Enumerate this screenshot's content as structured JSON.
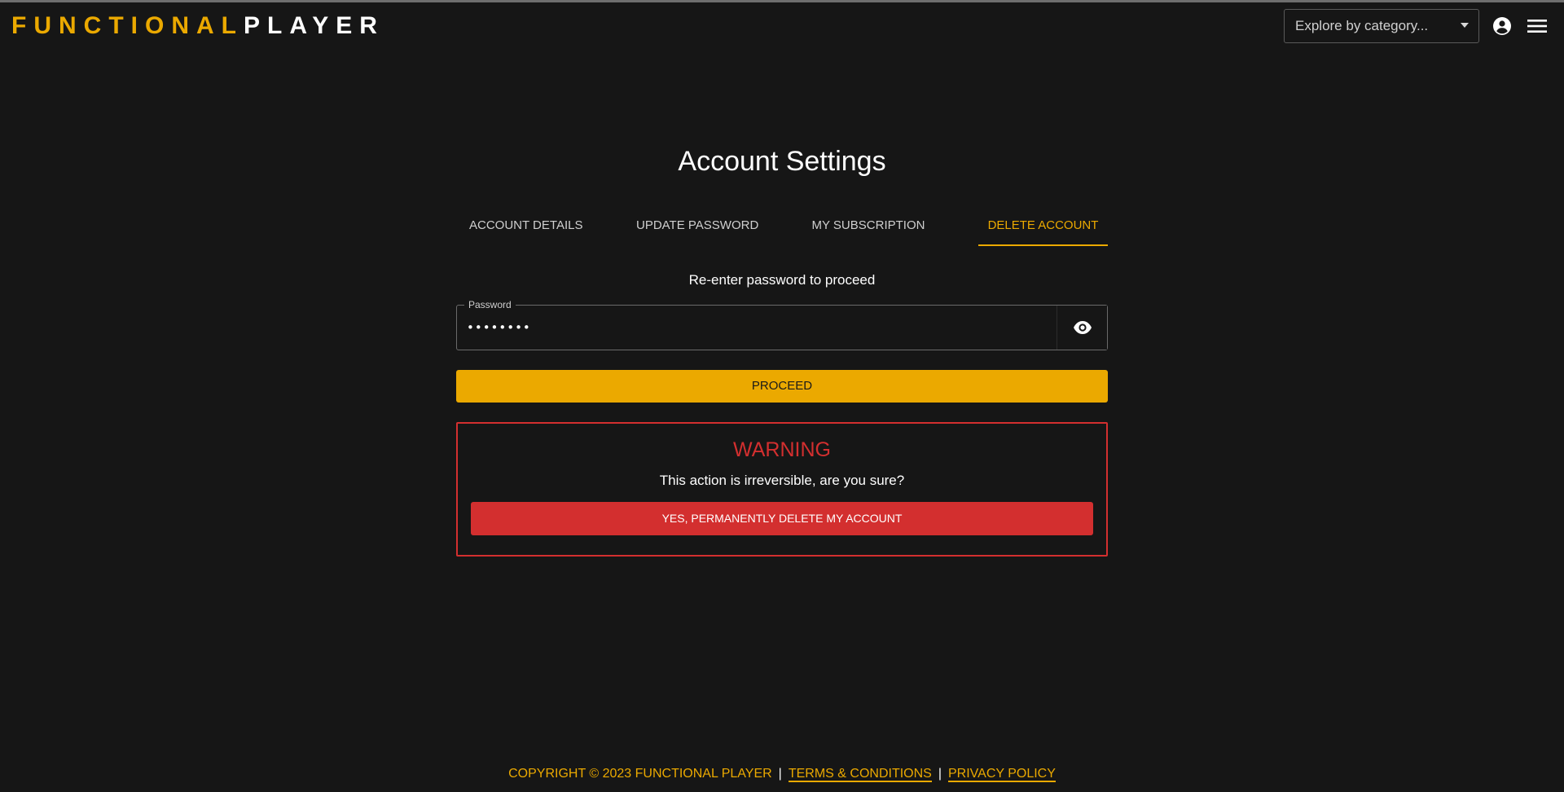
{
  "header": {
    "logo_part1": "FUNCTIONAL",
    "logo_part2": "PLAYER",
    "category_placeholder": "Explore by category...",
    "account_icon": "account-circle-icon",
    "menu_icon": "hamburger-menu-icon"
  },
  "page": {
    "title": "Account Settings",
    "tabs": [
      {
        "label": "ACCOUNT DETAILS",
        "active": false
      },
      {
        "label": "UPDATE PASSWORD",
        "active": false
      },
      {
        "label": "MY SUBSCRIPTION",
        "active": false
      },
      {
        "label": "DELETE ACCOUNT",
        "active": true
      }
    ]
  },
  "delete_section": {
    "prompt": "Re-enter password to proceed",
    "password_label": "Password",
    "password_value": "••••••••",
    "visibility_icon": "eye-icon",
    "proceed_label": "PROCEED",
    "warning_title": "WARNING",
    "warning_text": "This action is irreversible, are you sure?",
    "delete_label": "YES, PERMANENTLY DELETE MY ACCOUNT"
  },
  "footer": {
    "copyright": "COPYRIGHT © 2023 FUNCTIONAL PLAYER",
    "separator": "|",
    "terms": "TERMS & CONDITIONS",
    "privacy": "PRIVACY POLICY"
  },
  "colors": {
    "background": "#161616",
    "accent": "#eba900",
    "danger": "#d32f2f"
  }
}
